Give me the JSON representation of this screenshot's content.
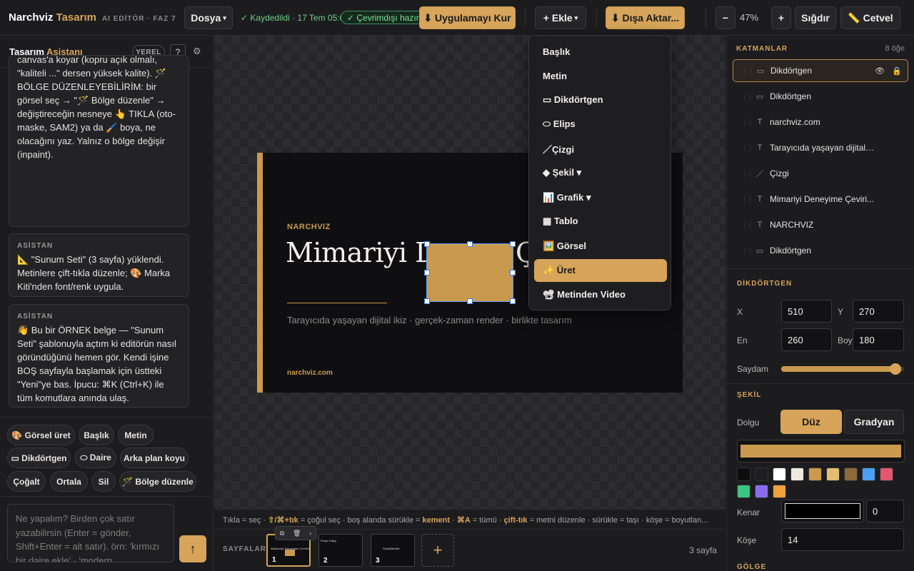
{
  "app": {
    "name": "Narchviz",
    "name_accent": "Tasarım",
    "subtitle": "AI EDİTÖR · FAZ 7"
  },
  "toolbar": {
    "file_label": "Dosya",
    "saved_status": "✓ Kaydedildi · 17 Tem 05:04",
    "offline_status": "✓ Çevrimdışı hazır",
    "install_label": "⬇ Uygulamayı Kur",
    "add_label": "+ Ekle",
    "export_label": "⬇ Dışa Aktar...",
    "zoom_out": "−",
    "zoom_value": "47%",
    "zoom_in": "+",
    "fit_label": "Sığdır",
    "ruler_label": "📏 Cetvel"
  },
  "assistant": {
    "title": "Tasarım",
    "title_accent": "Asistanı",
    "local_badge": "YEREL",
    "help": "?",
    "settings_icon": "⚙",
    "messages": [
      {
        "who": "",
        "text": "canvas'a koyar (kopru açık olmalı, \"kaliteli ...\" dersen yüksek kalite). 🪄 BÖLGE DÜZENLEYEBİLİRİM: bir görsel seç → \"🪄 Bölge düzenle\" → değiştireceğin nesneye 👆 TIKLA (oto-maske, SAM2) ya da 🖌️ boya, ne olacağını yaz. Yalnız o bölge değişir (inpaint)."
      },
      {
        "who": "ASİSTAN",
        "text": "📐 \"Sunum Seti\" (3 sayfa) yüklendi. Metinlere çift-tıkla düzenle; 🎨 Marka Kiti'nden font/renk uygula."
      },
      {
        "who": "ASİSTAN",
        "text": "👋 Bu bir ÖRNEK belge — \"Sunum Seti\" şablonuyla açtım ki editörün nasıl göründüğünü hemen gör. Kendi işine BOŞ sayfayla başlamak için üstteki \"Yeni\"ye bas. İpucu: ⌘K (Ctrl+K) ile tüm komutlara anında ulaş."
      }
    ],
    "quick_actions": [
      "🎨 Görsel üret",
      "Başlık",
      "Metin",
      "▭ Dikdörtgen",
      "⬭ Daire",
      "Arka plan koyu",
      "Çoğalt",
      "Ortala",
      "Sil",
      "🪄 Bölge düzenle"
    ],
    "composer_placeholder": "Ne yapalım? Birden çok satır yazabilirsin (Enter = gönder, Shift+Enter = alt satır). örn: 'kırmızı bir daire ekle' · 'modern",
    "send_icon": "↑"
  },
  "slide": {
    "kicker": "NARCHVIZ",
    "title_part1": "Mimariyi De",
    "title_part2": "Ç",
    "subtitle": "Tarayıcıda yaşayan dijital ikiz · gerçek-zaman render · birlikte tasarım",
    "url": "narchviz.com"
  },
  "hint_bar": [
    {
      "t": "Tıkla = seç · ",
      "b": false
    },
    {
      "t": "⇧/⌘+tık",
      "b": true
    },
    {
      "t": " = çoğul seç · boş alanda sürükle = ",
      "b": false
    },
    {
      "t": "kement",
      "b": true
    },
    {
      "t": " · ",
      "b": false
    },
    {
      "t": "⌘A",
      "b": true
    },
    {
      "t": " = tümü · ",
      "b": false
    },
    {
      "t": "çift-tık",
      "b": true
    },
    {
      "t": " = metni düzenle · sürükle = taşı · köşe = boyutlan...",
      "b": false
    }
  ],
  "pages": {
    "label": "SAYFALAR",
    "count_text": "3 sayfa",
    "add_icon": "+",
    "items": [
      {
        "num": "1",
        "title": "Mimariyi Deneyime Çevirin",
        "active": true
      },
      {
        "num": "2",
        "title": "Proje Salgı",
        "active": false
      },
      {
        "num": "3",
        "title": "Teşekkürler",
        "active": false
      }
    ],
    "mini_toolbar": [
      "⧉",
      "🗑",
      "›"
    ]
  },
  "add_menu": {
    "items": [
      "Başlık",
      "Metin",
      "▭ Dikdörtgen",
      "⬭ Elips",
      "／Çizgi",
      "◆ Şekil ▾",
      "📊 Grafik ▾",
      "▦ Tablo",
      "🖼️ Görsel",
      "✨ Üret",
      "📽 Metinden Video"
    ],
    "highlighted_index": 9
  },
  "layers": {
    "title": "KATMANLAR",
    "count": "8 öğe",
    "items": [
      {
        "icon": "▭",
        "name": "Dikdörtgen",
        "selected": true
      },
      {
        "icon": "▭",
        "name": "Dikdörtgen",
        "selected": false
      },
      {
        "icon": "T",
        "name": "narchviz.com",
        "selected": false
      },
      {
        "icon": "T",
        "name": "Tarayıcıda yaşayan dijital i...",
        "selected": false
      },
      {
        "icon": "／",
        "name": "Çizgi",
        "selected": false
      },
      {
        "icon": "T",
        "name": "Mimariyi Deneyime Çeviri...",
        "selected": false
      },
      {
        "icon": "T",
        "name": "NARCHVIZ",
        "selected": false
      },
      {
        "icon": "▭",
        "name": "Dikdörtgen",
        "selected": false
      }
    ],
    "eye_icon": "👁",
    "lock_icon": "🔒"
  },
  "props": {
    "section_title": "DİKDÖRTGEN",
    "x_label": "X",
    "x_value": "510",
    "y_label": "Y",
    "y_value": "270",
    "w_label": "En",
    "w_value": "260",
    "h_label": "Boy",
    "h_value": "180",
    "opacity_label": "Saydam",
    "opacity_fraction": 0.93
  },
  "shape": {
    "section_title": "ŞEKİL",
    "fill_label": "Dolgu",
    "solid_label": "Düz",
    "gradient_label": "Gradyan",
    "fill_color": "#c99a4e",
    "swatches": [
      "#0d0d0d",
      "#1e1e22",
      "#ffffff",
      "#efe9e0",
      "#c99a4e",
      "#e2bd72",
      "#8c6a3a",
      "#4a9ff5",
      "#e3566e",
      "#3cc483",
      "#8a6cf0",
      "#f0a13a"
    ],
    "stroke_label": "Kenar",
    "stroke_color": "#000000",
    "stroke_width": "0",
    "radius_label": "Köşe",
    "radius_value": "14",
    "shadow_title": "GÖLGE"
  }
}
